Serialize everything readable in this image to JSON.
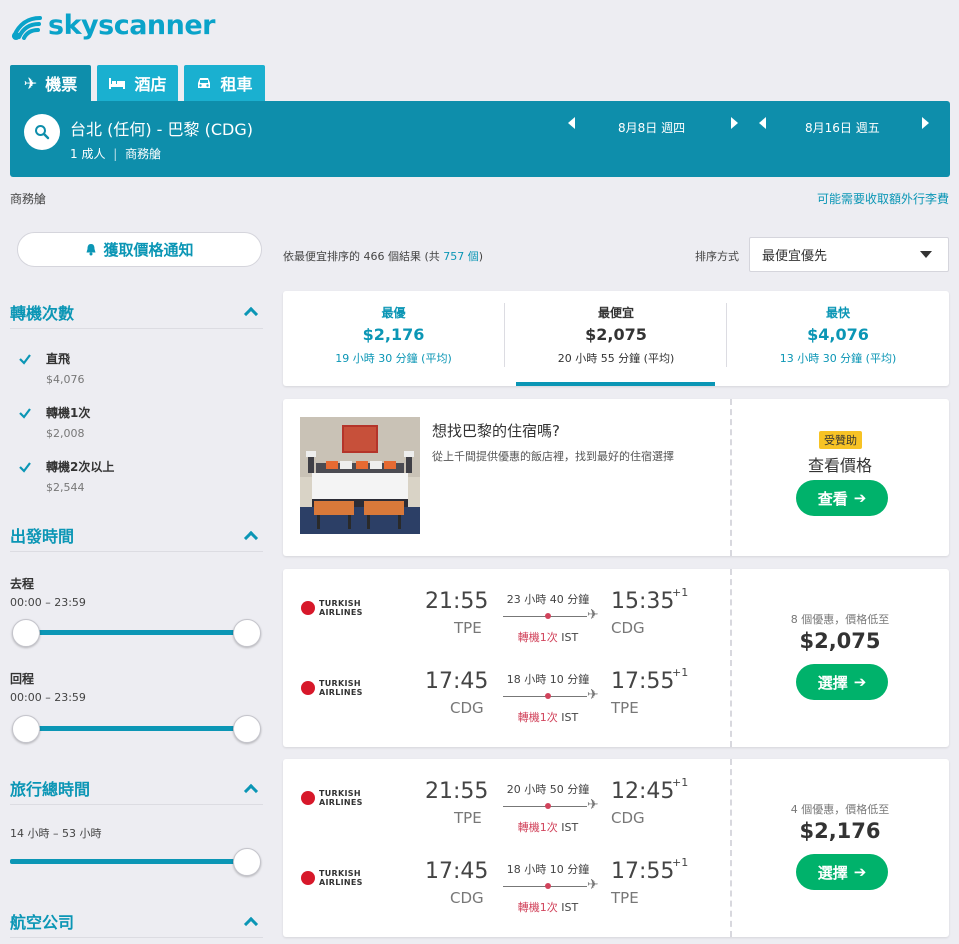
{
  "brand": {
    "name": "skyscanner",
    "color": "#0aa3c9"
  },
  "tabs": [
    {
      "label": "機票",
      "icon": "plane-icon",
      "active": true
    },
    {
      "label": "酒店",
      "icon": "bed-icon",
      "active": false
    },
    {
      "label": "租車",
      "icon": "car-icon",
      "active": false
    }
  ],
  "search": {
    "route": "台北 (任何) - 巴黎 (CDG)",
    "passengers": "1 成人",
    "cabin": "商務艙",
    "depart_date": "8月8日 週四",
    "return_date": "8月16日 週五"
  },
  "subheader": {
    "cabin": "商務艙",
    "baggage_link": "可能需要收取額外行李費"
  },
  "price_alert_label": "獲取價格通知",
  "results": {
    "prefix": "依最便宜排序的 466 個結果 (共 ",
    "total": "757 個",
    "suffix": ")"
  },
  "sort": {
    "label": "排序方式",
    "value": "最便宜優先"
  },
  "summary_tabs": [
    {
      "title": "最優",
      "price": "$2,176",
      "duration": "19 小時 30 分鐘 (平均)",
      "active": false
    },
    {
      "title": "最便宜",
      "price": "$2,075",
      "duration": "20 小時 55 分鐘 (平均)",
      "active": true
    },
    {
      "title": "最快",
      "price": "$4,076",
      "duration": "13 小時 30 分鐘 (平均)",
      "active": false
    }
  ],
  "sidebar": {
    "stops": {
      "title": "轉機次數",
      "options": [
        {
          "label": "直飛",
          "price": "$4,076",
          "checked": true
        },
        {
          "label": "轉機1次",
          "price": "$2,008",
          "checked": true
        },
        {
          "label": "轉機2次以上",
          "price": "$2,544",
          "checked": true
        }
      ]
    },
    "departure_times": {
      "title": "出發時間",
      "outbound": {
        "label": "去程",
        "range": "00:00 – 23:59"
      },
      "return": {
        "label": "回程",
        "range": "00:00 – 23:59"
      }
    },
    "journey_duration": {
      "title": "旅行總時間",
      "range": "14 小時 – 53 小時"
    },
    "airlines": {
      "title": "航空公司"
    }
  },
  "hotel_ad": {
    "title": "想找巴黎的住宿嗎?",
    "subtitle": "從上千間提供優惠的飯店裡，找到最好的住宿選擇",
    "sponsored": "受贊助",
    "cta_text": "查看價格",
    "button_label": "查看"
  },
  "flights": [
    {
      "deals": "8 個優惠，價格低至",
      "price": "$2,075",
      "button_label": "選擇",
      "legs": [
        {
          "airline": "TURKISH AIRLINES",
          "dep_time": "21:55",
          "dep_code": "TPE",
          "arr_time": "15:35",
          "arr_code": "CDG",
          "plus": "+1",
          "duration": "23 小時 40 分鐘",
          "stops": "轉機1次",
          "via": "IST"
        },
        {
          "airline": "TURKISH AIRLINES",
          "dep_time": "17:45",
          "dep_code": "CDG",
          "arr_time": "17:55",
          "arr_code": "TPE",
          "plus": "+1",
          "duration": "18 小時 10 分鐘",
          "stops": "轉機1次",
          "via": "IST"
        }
      ]
    },
    {
      "deals": "4 個優惠，價格低至",
      "price": "$2,176",
      "button_label": "選擇",
      "legs": [
        {
          "airline": "TURKISH AIRLINES",
          "dep_time": "21:55",
          "dep_code": "TPE",
          "arr_time": "12:45",
          "arr_code": "CDG",
          "plus": "+1",
          "duration": "20 小時 50 分鐘",
          "stops": "轉機1次",
          "via": "IST"
        },
        {
          "airline": "TURKISH AIRLINES",
          "dep_time": "17:45",
          "dep_code": "CDG",
          "arr_time": "17:55",
          "arr_code": "TPE",
          "plus": "+1",
          "duration": "18 小時 10 分鐘",
          "stops": "轉機1次",
          "via": "IST"
        }
      ]
    }
  ]
}
